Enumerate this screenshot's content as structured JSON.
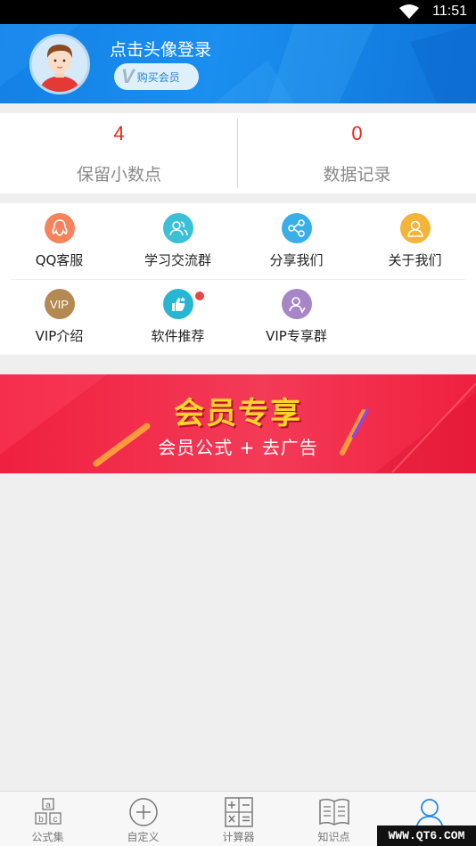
{
  "status_bar": {
    "time": "11:51"
  },
  "header": {
    "login_prompt": "点击头像登录",
    "vip_button": "购买会员",
    "vip_mark": "V"
  },
  "stats": [
    {
      "value": "4",
      "label": "保留小数点"
    },
    {
      "value": "0",
      "label": "数据记录"
    }
  ],
  "grid": {
    "items": [
      {
        "label": "QQ客服",
        "icon": "qq-icon",
        "color": "#f5845c"
      },
      {
        "label": "学习交流群",
        "icon": "group-icon",
        "color": "#3cc0d8"
      },
      {
        "label": "分享我们",
        "icon": "share-icon",
        "color": "#3aaee8"
      },
      {
        "label": "关于我们",
        "icon": "about-icon",
        "color": "#f3b43a"
      },
      {
        "label": "VIP介绍",
        "icon": "vip-icon",
        "icon_text": "VIP",
        "color": "#b48a52"
      },
      {
        "label": "软件推荐",
        "icon": "thumbs-up-icon",
        "color": "#26b6d4",
        "badge": true,
        "badge_color": "#e84545"
      },
      {
        "label": "VIP专享群",
        "icon": "vip-group-icon",
        "color": "#a686c6"
      }
    ]
  },
  "banner": {
    "title": "会员专享",
    "subtitle": "会员公式 + 去广告"
  },
  "tab_bar": {
    "tabs": [
      {
        "label": "公式集",
        "icon": "formula-set-icon",
        "icon_letters": [
          "a",
          "b",
          "c"
        ]
      },
      {
        "label": "自定义",
        "icon": "add-circle-icon"
      },
      {
        "label": "计算器",
        "icon": "calculator-icon"
      },
      {
        "label": "知识点",
        "icon": "book-icon"
      },
      {
        "label": "",
        "icon": "user-icon",
        "active": true
      }
    ]
  },
  "watermark": "WWW.QT6.COM"
}
